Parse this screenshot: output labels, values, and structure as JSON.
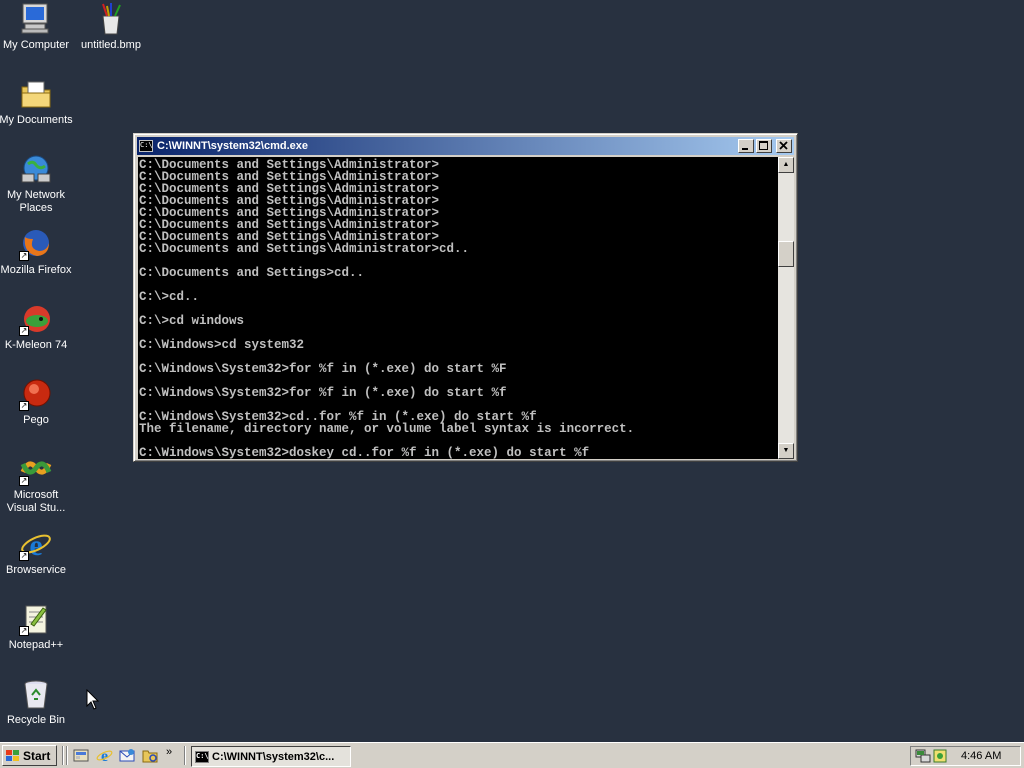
{
  "desktop": {
    "icons": [
      {
        "label": "My Computer",
        "icon": "my-computer-icon"
      },
      {
        "label": "untitled.bmp",
        "icon": "bitmap-file-icon"
      },
      {
        "label": "My Documents",
        "icon": "my-documents-icon"
      },
      {
        "label": "My Network Places",
        "icon": "network-places-icon"
      },
      {
        "label": "Mozilla Firefox",
        "icon": "firefox-icon"
      },
      {
        "label": "K-Meleon 74",
        "icon": "k-meleon-icon"
      },
      {
        "label": "Pego",
        "icon": "pego-icon"
      },
      {
        "label": "Microsoft Visual Stu...",
        "icon": "visual-studio-icon"
      },
      {
        "label": "Browservice",
        "icon": "internet-explorer-icon"
      },
      {
        "label": "Notepad++",
        "icon": "notepad-plus-plus-icon"
      },
      {
        "label": "Recycle Bin",
        "icon": "recycle-bin-icon"
      }
    ],
    "background_color": "#283140"
  },
  "console_window": {
    "title": "C:\\WINNT\\system32\\cmd.exe",
    "text_color": "#c0c0c0",
    "lines": [
      "C:\\Documents and Settings\\Administrator>",
      "C:\\Documents and Settings\\Administrator>",
      "C:\\Documents and Settings\\Administrator>",
      "C:\\Documents and Settings\\Administrator>",
      "C:\\Documents and Settings\\Administrator>",
      "C:\\Documents and Settings\\Administrator>",
      "C:\\Documents and Settings\\Administrator>",
      "C:\\Documents and Settings\\Administrator>cd..",
      "",
      "C:\\Documents and Settings>cd..",
      "",
      "C:\\>cd..",
      "",
      "C:\\>cd windows",
      "",
      "C:\\Windows>cd system32",
      "",
      "C:\\Windows\\System32>for %f in (*.exe) do start %F",
      "",
      "C:\\Windows\\System32>for %f in (*.exe) do start %f",
      "",
      "C:\\Windows\\System32>cd..for %f in (*.exe) do start %f",
      "The filename, directory name, or volume label syntax is incorrect.",
      "",
      "C:\\Windows\\System32>doskey cd..for %f in (*.exe) do start %f"
    ]
  },
  "taskbar": {
    "start_label": "Start",
    "quick_launch": [
      "show-desktop-icon",
      "internet-explorer-icon",
      "outlook-express-icon",
      "explorer-icon"
    ],
    "chevron": "»",
    "task_button_label": "C:\\WINNT\\system32\\c...",
    "clock": "4:46 AM"
  }
}
